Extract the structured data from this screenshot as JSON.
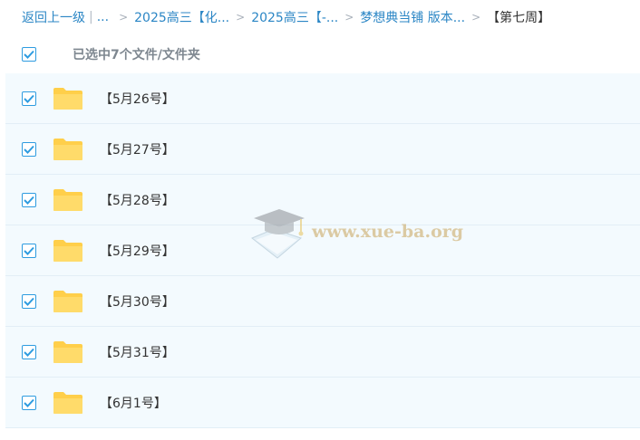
{
  "breadcrumb": {
    "back_label": "返回上一级",
    "separator_bar": "|",
    "ellipsis": "...",
    "arrow": ">",
    "items": [
      {
        "label": "2025高三【化..."
      },
      {
        "label": "2025高三【-..."
      },
      {
        "label": "梦想典当铺 版本..."
      }
    ],
    "current": "【第七周】"
  },
  "selection": {
    "label": "已选中7个文件/文件夹",
    "checked": true
  },
  "files": [
    {
      "name": "【5月26号】",
      "type": "folder",
      "checked": true
    },
    {
      "name": "【5月27号】",
      "type": "folder",
      "checked": true
    },
    {
      "name": "【5月28号】",
      "type": "folder",
      "checked": true
    },
    {
      "name": "【5月29号】",
      "type": "folder",
      "checked": true
    },
    {
      "name": "【5月30号】",
      "type": "folder",
      "checked": true
    },
    {
      "name": "【5月31号】",
      "type": "folder",
      "checked": true
    },
    {
      "name": "【6月1号】",
      "type": "folder",
      "checked": true
    }
  ],
  "watermark": {
    "text": "www.xue-ba.org",
    "icon": "graduation-cap-icon"
  },
  "colors": {
    "link": "#2b86c5",
    "checkbox": "#2e9ce0",
    "row_bg": "#f3fafe",
    "folder": "#ffd659"
  }
}
